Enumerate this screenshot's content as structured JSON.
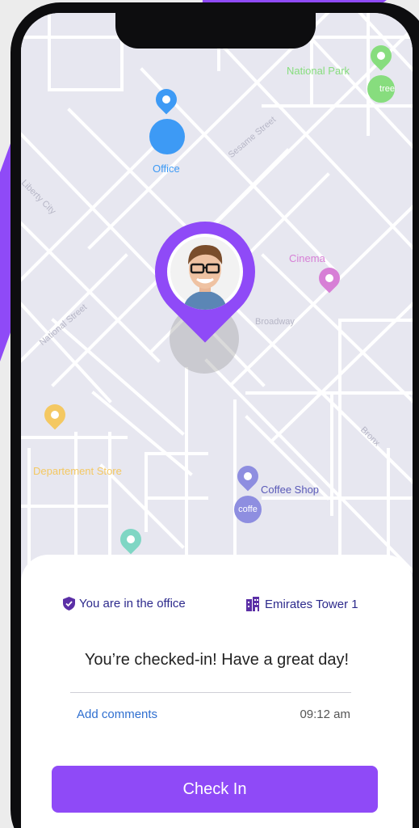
{
  "colors": {
    "accent": "#8f4af7",
    "office_blue": "#3d9af5",
    "park_green": "#87dd7e",
    "cinema_pink": "#d77fd6",
    "store_yellow": "#f4c862",
    "coffee_lilac": "#8e8ee0",
    "teal": "#7fd6c4",
    "status_text": "#2d2a8c",
    "link_blue": "#2f6fd0"
  },
  "map": {
    "places": {
      "national_park": "National Park",
      "tree_badge": "tree",
      "office": "Office",
      "cinema": "Cinema",
      "department_store": "Departement Store",
      "coffee_shop": "Coffee Shop",
      "coffee_badge": "coffe"
    },
    "streets": {
      "sesame": "Sesame Street",
      "liberty": "Liberty City",
      "national": "National Street",
      "broadway": "Broadway",
      "bronx": "Bronx"
    },
    "icons": {
      "user_pin": "user-location-pin",
      "pin": "map-pin"
    }
  },
  "sheet": {
    "status_text": "You are in the office",
    "status_icon": "verified-shield-icon",
    "building_text": "Emirates Tower 1",
    "building_icon": "building-icon",
    "headline": "You’re checked-in! Have a great day!",
    "add_comments": "Add comments",
    "time": "09:12 am",
    "check_in_label": "Check In"
  }
}
